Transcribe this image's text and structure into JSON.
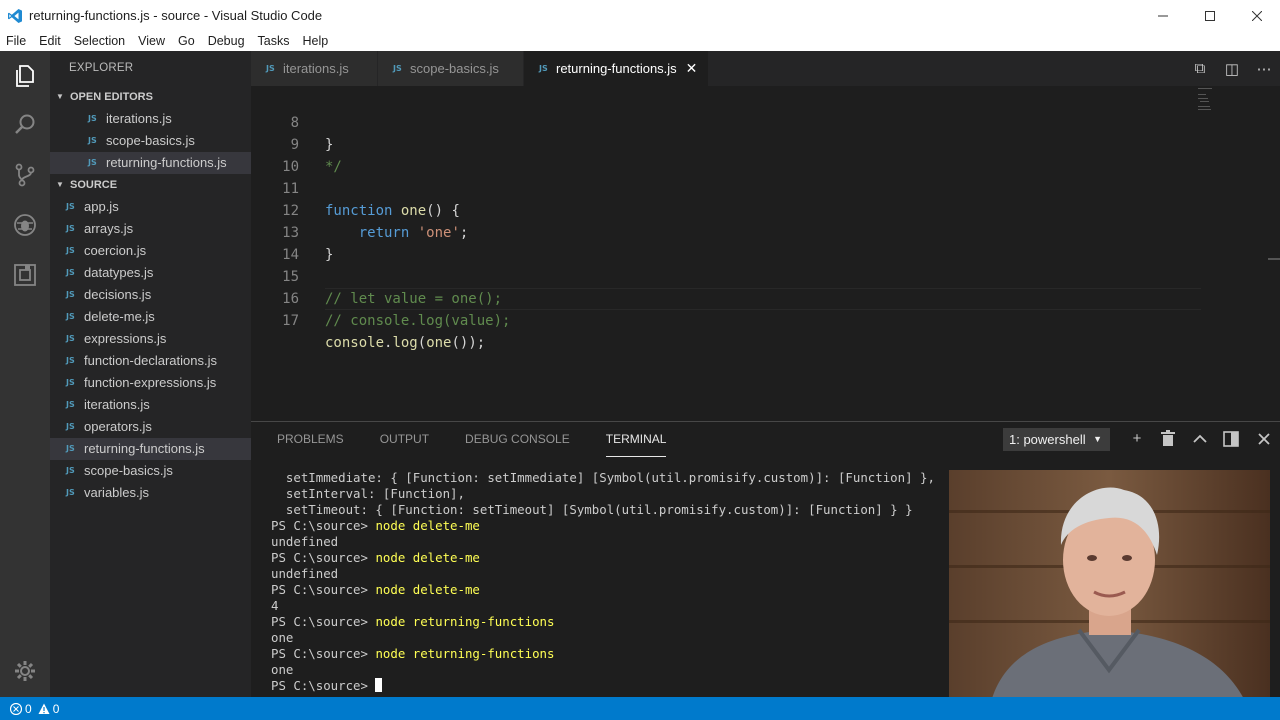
{
  "window": {
    "title": "returning-functions.js - source - Visual Studio Code",
    "controls": [
      "minimize",
      "maximize",
      "close"
    ]
  },
  "menu": [
    "File",
    "Edit",
    "Selection",
    "View",
    "Go",
    "Debug",
    "Tasks",
    "Help"
  ],
  "sidebar": {
    "title": "EXPLORER",
    "open_editors_label": "OPEN EDITORS",
    "open_editors": [
      "iterations.js",
      "scope-basics.js",
      "returning-functions.js"
    ],
    "folder_label": "SOURCE",
    "files": [
      "app.js",
      "arrays.js",
      "coercion.js",
      "datatypes.js",
      "decisions.js",
      "delete-me.js",
      "expressions.js",
      "function-declarations.js",
      "function-expressions.js",
      "iterations.js",
      "operators.js",
      "returning-functions.js",
      "scope-basics.js",
      "variables.js"
    ],
    "file_badge": "JS"
  },
  "tabs": [
    {
      "label": "iterations.js",
      "active": false
    },
    {
      "label": "scope-basics.js",
      "active": false
    },
    {
      "label": "returning-functions.js",
      "active": true
    }
  ],
  "editor": {
    "line_numbers": [
      "8",
      "9",
      "10",
      "11",
      "12",
      "13",
      "14",
      "15",
      "16",
      "17"
    ],
    "lines": {
      "l8": "}",
      "l9": "*/",
      "l11_kw": "function",
      "l11_fn": "one",
      "l11_rest": "() {",
      "l12_kw": "return",
      "l12_str": "'one'",
      "l12_rest": ";",
      "l13": "}",
      "l15": "// let value = one();",
      "l16": "// console.log(value);",
      "l17_obj": "console",
      "l17_dot": ".",
      "l17_fn": "log",
      "l17_p1": "(",
      "l17_fn2": "one",
      "l17_rest": "());"
    }
  },
  "panel": {
    "tabs": [
      "PROBLEMS",
      "OUTPUT",
      "DEBUG CONSOLE",
      "TERMINAL"
    ],
    "active_tab": "TERMINAL",
    "terminal_select": "1: powershell",
    "terminal": {
      "l1": "  setImmediate: { [Function: setImmediate] [Symbol(util.promisify.custom)]: [Function] },",
      "l2": "  setInterval: [Function],",
      "l3": "  setTimeout: { [Function: setTimeout] [Symbol(util.promisify.custom)]: [Function] } }",
      "prompt": "PS C:\\source> ",
      "cmd1": "node delete-me",
      "out1": "undefined",
      "cmd2": "node delete-me",
      "out2": "undefined",
      "cmd3": "node delete-me",
      "out3": "4",
      "cmd4": "node returning-functions",
      "out4": "one",
      "cmd5": "node returning-functions",
      "out5": "one"
    }
  },
  "status": {
    "errors": "0",
    "warnings": "0"
  },
  "colors": {
    "status_bar": "#007acc",
    "activity_bar": "#333333",
    "sidebar": "#252526",
    "editor_bg": "#1e1e1e"
  }
}
